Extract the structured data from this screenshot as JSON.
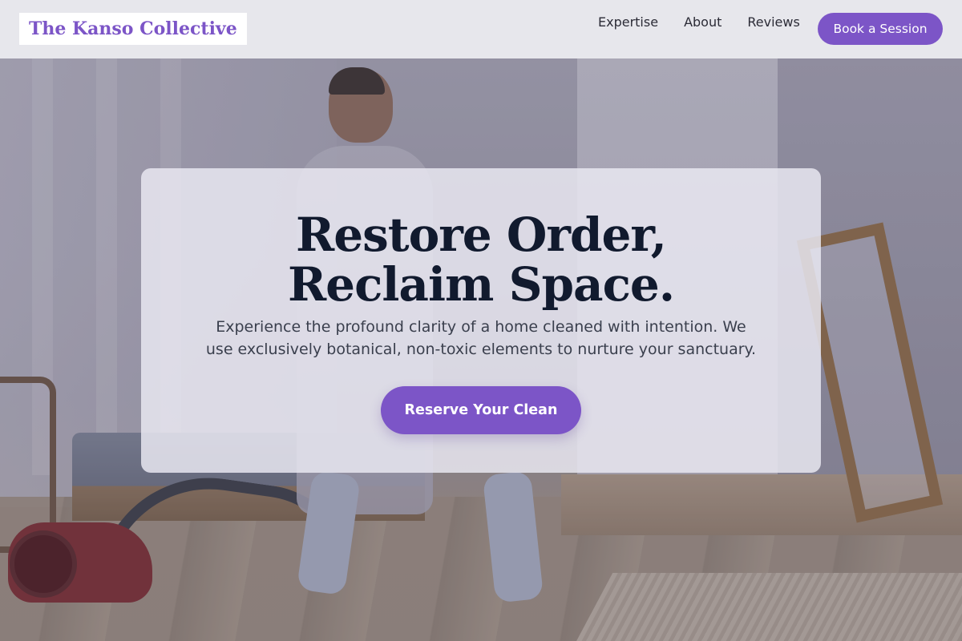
{
  "brand": {
    "name": "The Kanso Collective"
  },
  "nav": {
    "items": [
      {
        "label": "Expertise"
      },
      {
        "label": "About"
      },
      {
        "label": "Reviews"
      }
    ],
    "cta_label": "Book a Session"
  },
  "hero": {
    "title": "Restore Order, Reclaim Space.",
    "subtitle": "Experience the profound clarity of a home cleaned with intention. We use exclusively botanical, non-toxic elements to nurture your sanctuary.",
    "cta_label": "Reserve Your Clean"
  },
  "colors": {
    "accent": "#7c55c7",
    "heading": "#111a2e",
    "header_bg": "#ececf0"
  }
}
